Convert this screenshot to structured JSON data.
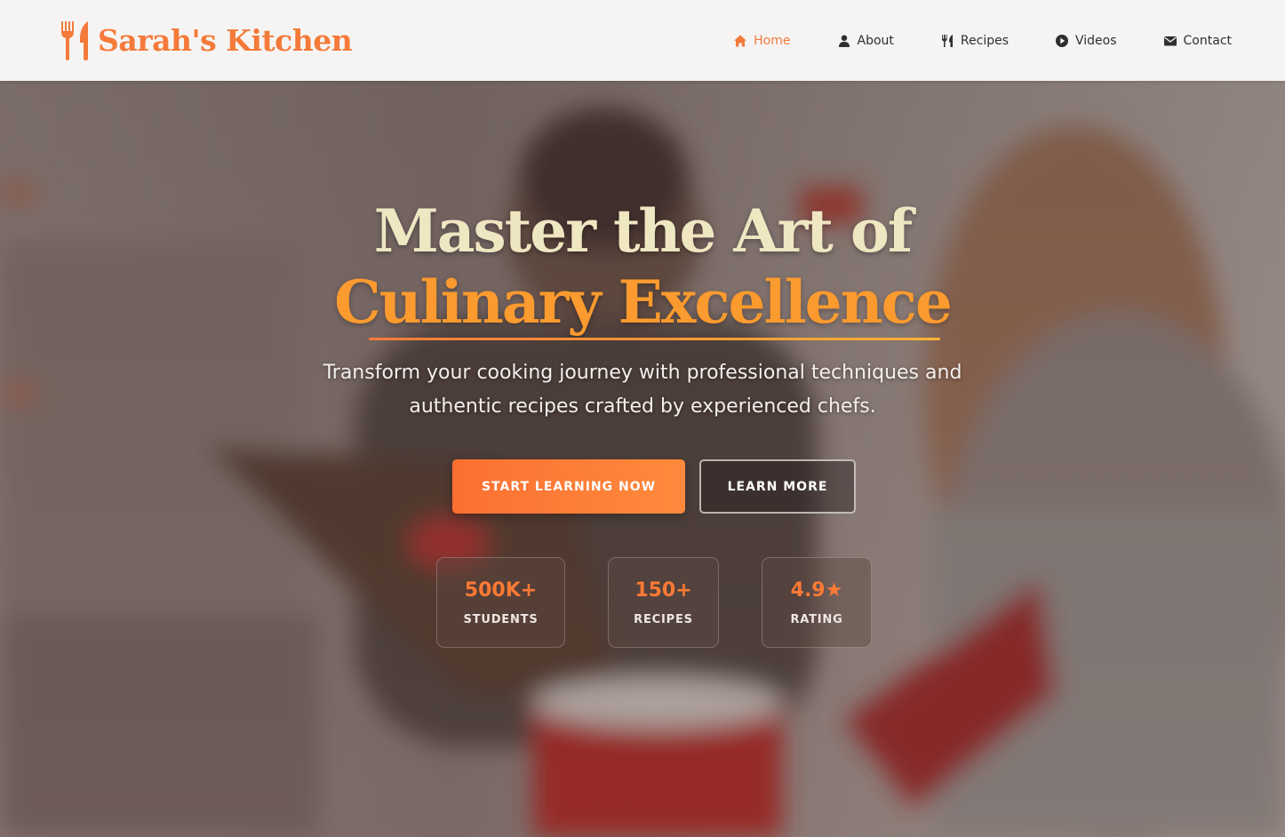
{
  "brand": {
    "name": "Sarah's Kitchen",
    "icon": "utensils-icon",
    "color": "#f47a3a"
  },
  "nav": {
    "items": [
      {
        "label": "Home",
        "icon": "home-icon",
        "active": true
      },
      {
        "label": "About",
        "icon": "user-icon",
        "active": false
      },
      {
        "label": "Recipes",
        "icon": "utensils-icon",
        "active": false
      },
      {
        "label": "Videos",
        "icon": "play-circle-icon",
        "active": false
      },
      {
        "label": "Contact",
        "icon": "envelope-icon",
        "active": false
      }
    ],
    "active_color": "#f47a3a"
  },
  "hero": {
    "title_line1": "Master the Art of",
    "title_line2": "Culinary Excellence",
    "subtitle": "Transform your cooking journey with professional techniques and authentic recipes crafted by experienced chefs.",
    "primary_button": "START LEARNING NOW",
    "secondary_button": "LEARN MORE",
    "accent_color": "#fb7031"
  },
  "stats": [
    {
      "value": "500K+",
      "label": "STUDENTS"
    },
    {
      "value": "150+",
      "label": "RECIPES"
    },
    {
      "value": "4.9★",
      "label": "RATING"
    }
  ]
}
